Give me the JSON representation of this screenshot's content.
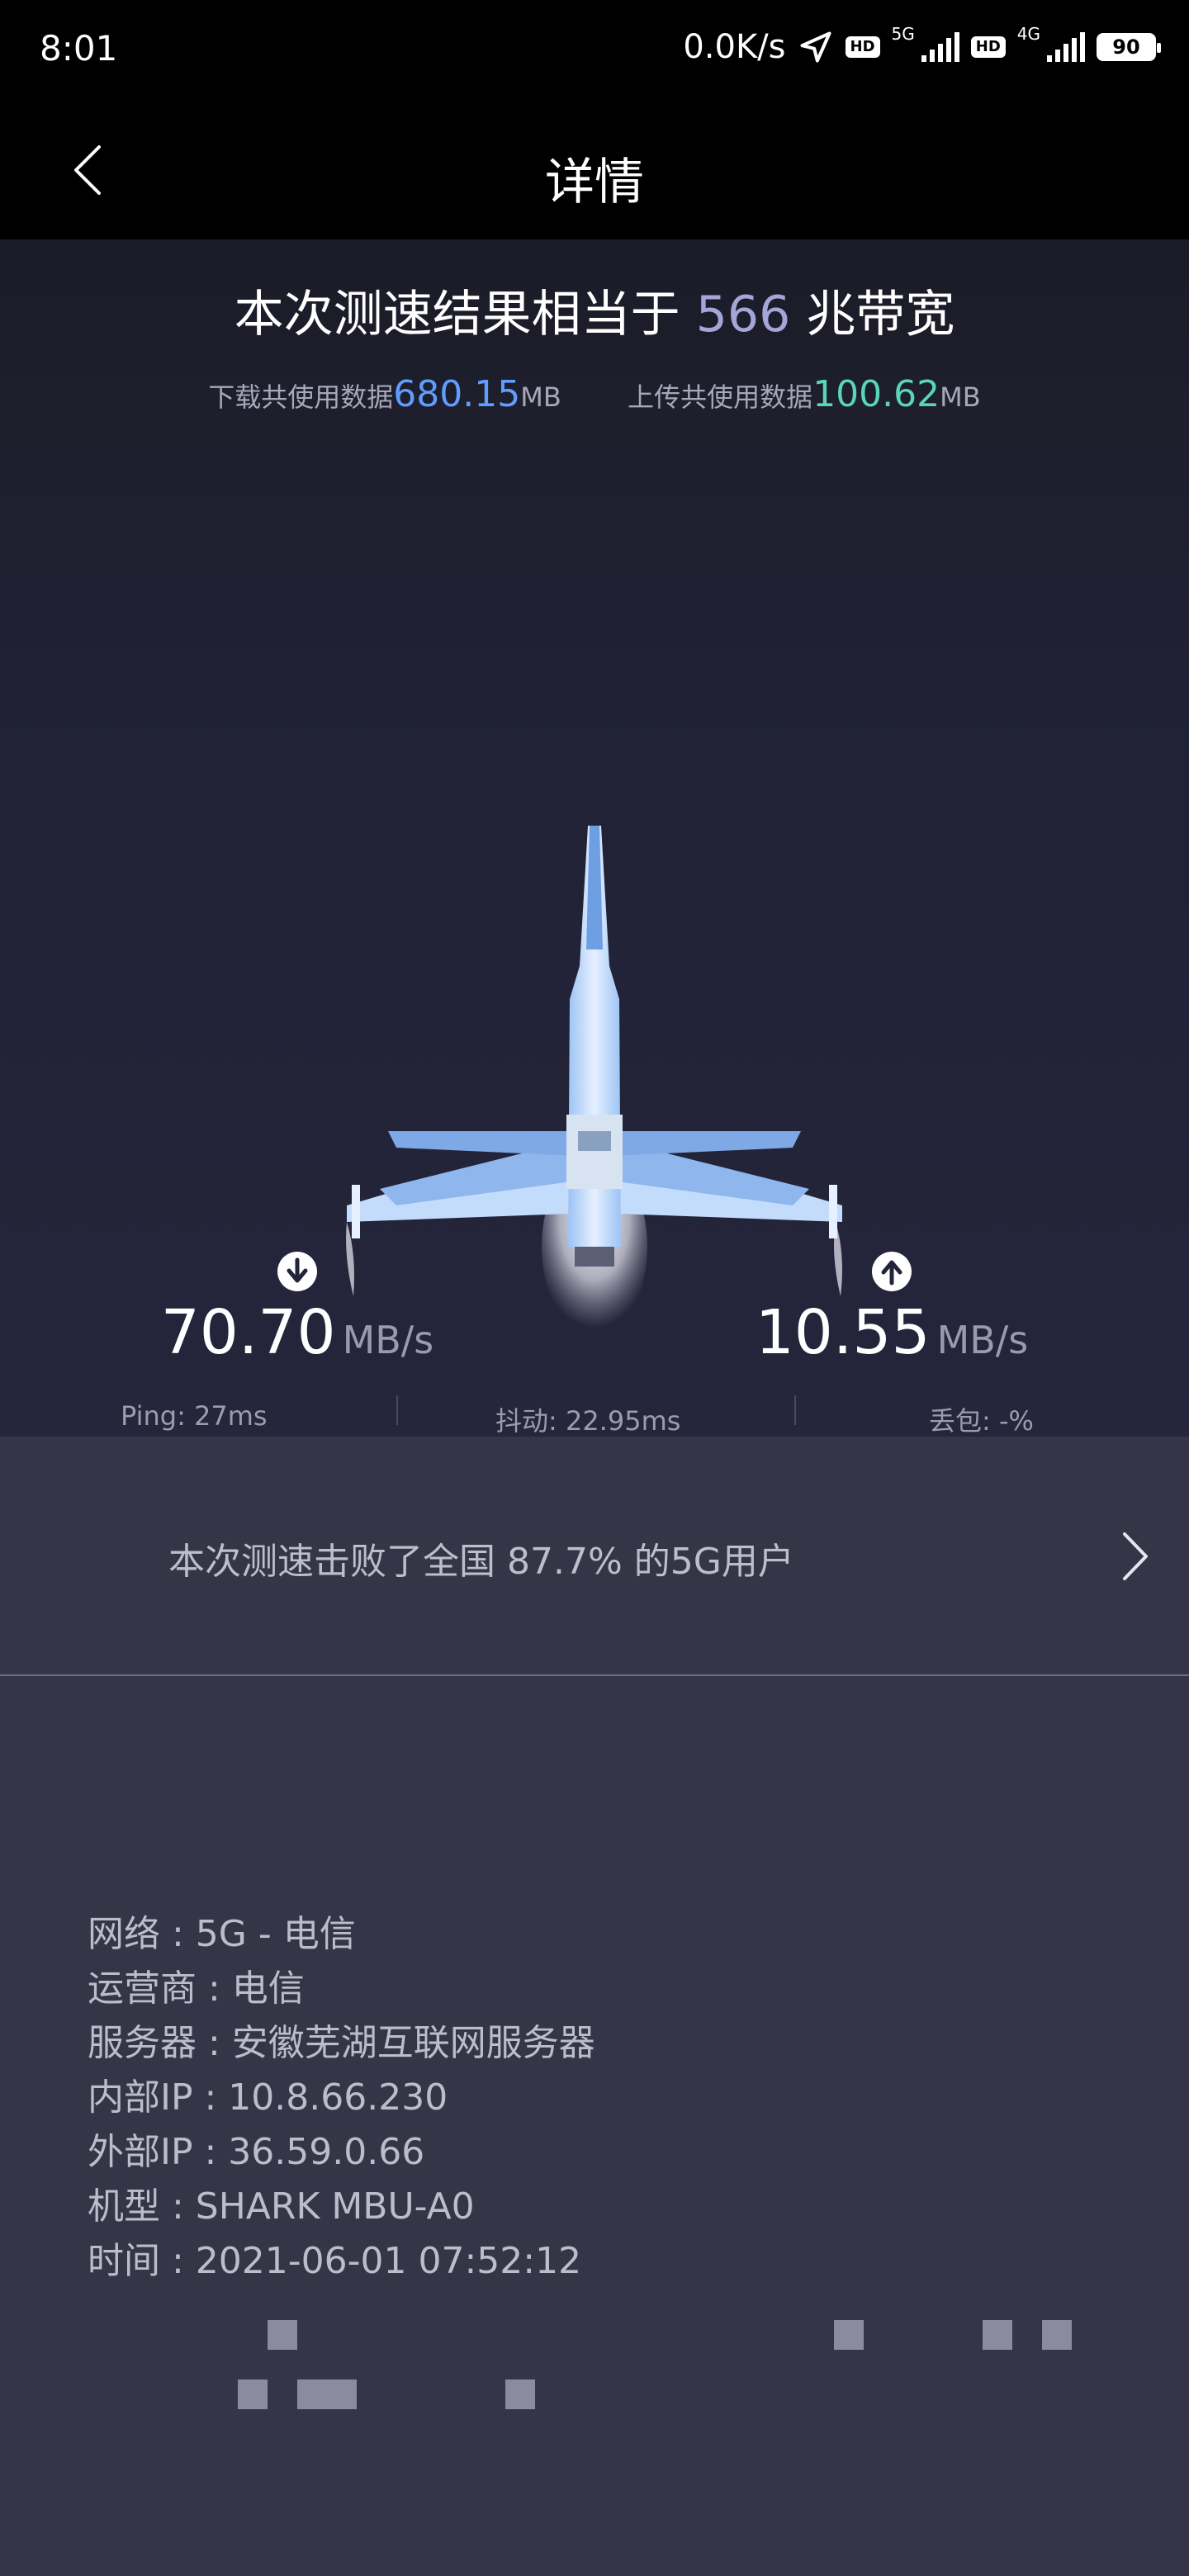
{
  "status_bar": {
    "time": "8:01",
    "net_speed": "0.0K/s",
    "hd1": "HD",
    "net1": "5G",
    "hd2": "HD",
    "net2": "4G",
    "battery": "90"
  },
  "header": {
    "title": "详情"
  },
  "summary": {
    "headline_prefix": "本次测速结果相当于",
    "headline_value": "566",
    "headline_suffix": "兆带宽",
    "download_label": "下载共使用数据",
    "download_value": "680.15",
    "download_unit": "MB",
    "upload_label": "上传共使用数据",
    "upload_value": "100.62",
    "upload_unit": "MB"
  },
  "speeds": {
    "download_value": "70.70",
    "download_unit": "MB/s",
    "upload_value": "10.55",
    "upload_unit": "MB/s"
  },
  "stats": {
    "ping": "Ping:  27ms",
    "jitter": "抖动:  22.95ms",
    "loss": "丢包:  -%"
  },
  "rank": {
    "text": "本次测速击败了全国 87.7% 的5G用户"
  },
  "info": {
    "lines": [
      "网络 : 5G - 电信",
      "运营商 : 电信",
      "服务器 : 安徽芜湖互联网服务器",
      "内部IP : 10.8.66.230",
      "外部IP : 36.59.0.66",
      "机型 : SHARK MBU-A0",
      "时间 : 2021-06-01 07:52:12"
    ]
  },
  "icons": {
    "back": "chevron-left-icon",
    "download": "download-arrow-icon",
    "upload": "upload-arrow-icon",
    "rank": "chevron-right-icon"
  },
  "colors": {
    "download_accent": "#5f9dff",
    "upload_accent": "#59d6b3",
    "headline_value": "#a3a6d6"
  }
}
